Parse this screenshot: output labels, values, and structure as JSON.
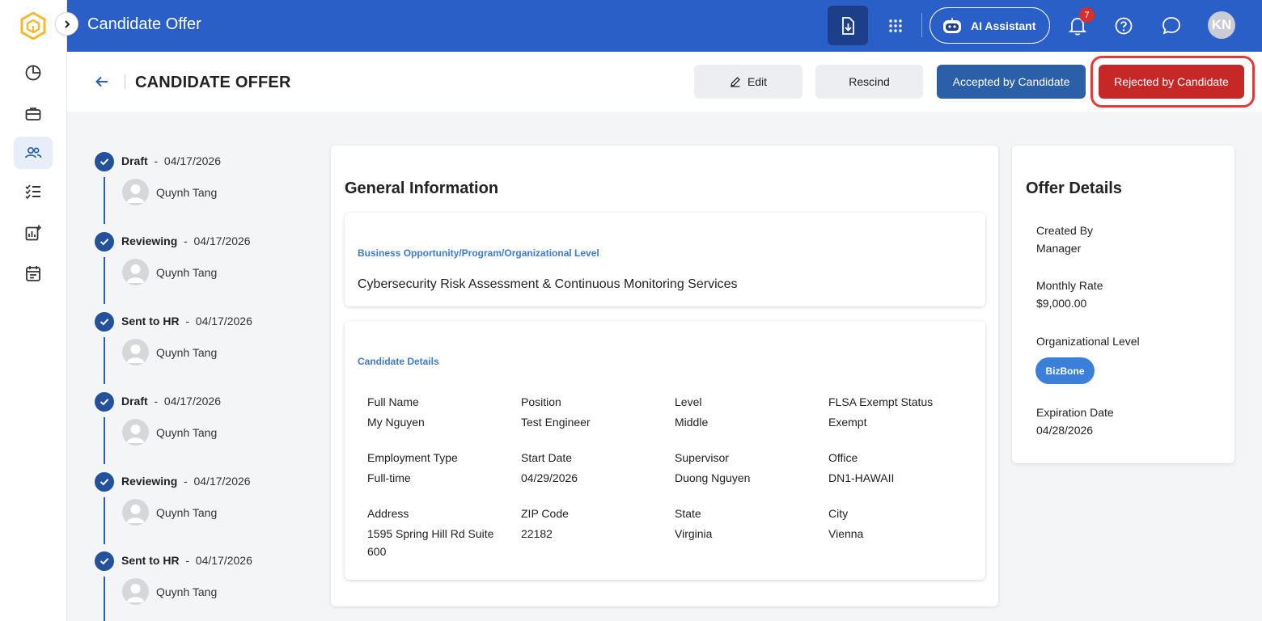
{
  "app": {
    "title": "Candidate Offer"
  },
  "topbar": {
    "ai_assistant_label": "AI Assistant",
    "notification_count": "7",
    "user_initials": "KN"
  },
  "header": {
    "title": "CANDIDATE OFFER",
    "edit_label": "Edit",
    "rescind_label": "Rescind",
    "accepted_label": "Accepted by Candidate",
    "rejected_label": "Rejected by Candidate"
  },
  "timeline": [
    {
      "status": "Draft",
      "date": "04/17/2026",
      "user": "Quynh Tang"
    },
    {
      "status": "Reviewing",
      "date": "04/17/2026",
      "user": "Quynh Tang"
    },
    {
      "status": "Sent to HR",
      "date": "04/17/2026",
      "user": "Quynh Tang"
    },
    {
      "status": "Draft",
      "date": "04/17/2026",
      "user": "Quynh Tang"
    },
    {
      "status": "Reviewing",
      "date": "04/17/2026",
      "user": "Quynh Tang"
    },
    {
      "status": "Sent to HR",
      "date": "04/17/2026",
      "user": "Quynh Tang"
    }
  ],
  "general": {
    "title": "General Information",
    "opportunity_label": "Business Opportunity/Program/Organizational Level",
    "opportunity_value": "Cybersecurity Risk Assessment & Continuous Monitoring Services",
    "candidate_label": "Candidate Details",
    "fields": [
      {
        "label": "Full Name",
        "value": "My Nguyen"
      },
      {
        "label": "Position",
        "value": "Test Engineer"
      },
      {
        "label": "Level",
        "value": "Middle"
      },
      {
        "label": "FLSA Exempt Status",
        "value": "Exempt"
      },
      {
        "label": "Employment Type",
        "value": "Full-time"
      },
      {
        "label": "Start Date",
        "value": "04/29/2026"
      },
      {
        "label": "Supervisor",
        "value": "Duong Nguyen"
      },
      {
        "label": "Office",
        "value": "DN1-HAWAII"
      },
      {
        "label": "Address",
        "value": "1595 Spring Hill Rd Suite 600"
      },
      {
        "label": "ZIP Code",
        "value": "22182"
      },
      {
        "label": "State",
        "value": "Virginia"
      },
      {
        "label": "City",
        "value": "Vienna"
      }
    ]
  },
  "offer": {
    "title": "Offer Details",
    "created_by_label": "Created By",
    "created_by_value": "Manager",
    "monthly_rate_label": "Monthly Rate",
    "monthly_rate_value": "$9,000.00",
    "org_level_label": "Organizational Level",
    "org_level_value": "BizBone",
    "expiration_label": "Expiration Date",
    "expiration_value": "04/28/2026"
  },
  "colors": {
    "primary": "#2b5fc8",
    "accept": "#2b5fa8",
    "reject": "#c62828",
    "link_blue": "#3d7ad6"
  }
}
